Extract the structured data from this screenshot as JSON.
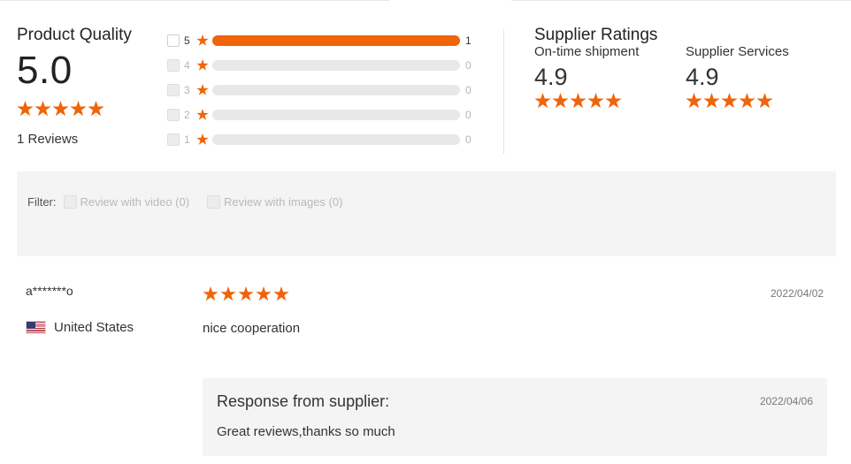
{
  "product_quality": {
    "title": "Product Quality",
    "score": "5.0",
    "stars": 5,
    "reviews_label": "1 Reviews"
  },
  "distribution": [
    {
      "stars": "5",
      "count": "1",
      "fraction": 1.0
    },
    {
      "stars": "4",
      "count": "0",
      "fraction": 0.0
    },
    {
      "stars": "3",
      "count": "0",
      "fraction": 0.0
    },
    {
      "stars": "2",
      "count": "0",
      "fraction": 0.0
    },
    {
      "stars": "1",
      "count": "0",
      "fraction": 0.0
    }
  ],
  "supplier_ratings": {
    "title": "Supplier Ratings",
    "shipment": {
      "label": "On-time shipment",
      "score": "4.9",
      "stars": 5
    },
    "services": {
      "label": "Supplier Services",
      "score": "4.9",
      "stars": 5
    }
  },
  "filter": {
    "label": "Filter:",
    "video_option": "Review with video (0)",
    "images_option": "Review with images (0)"
  },
  "review": {
    "reviewer": "a*******o",
    "country": "United States",
    "stars": 5,
    "date": "2022/04/02",
    "text": "nice cooperation",
    "response": {
      "title": "Response from supplier:",
      "date": "2022/04/06",
      "text": "Great reviews,thanks so much"
    }
  },
  "colors": {
    "accent": "#f0640a",
    "bar_track": "#e8e8e8",
    "panel_bg": "#f4f4f4"
  },
  "icons": [
    "star-icon",
    "checkbox-icon",
    "us-flag-icon"
  ]
}
